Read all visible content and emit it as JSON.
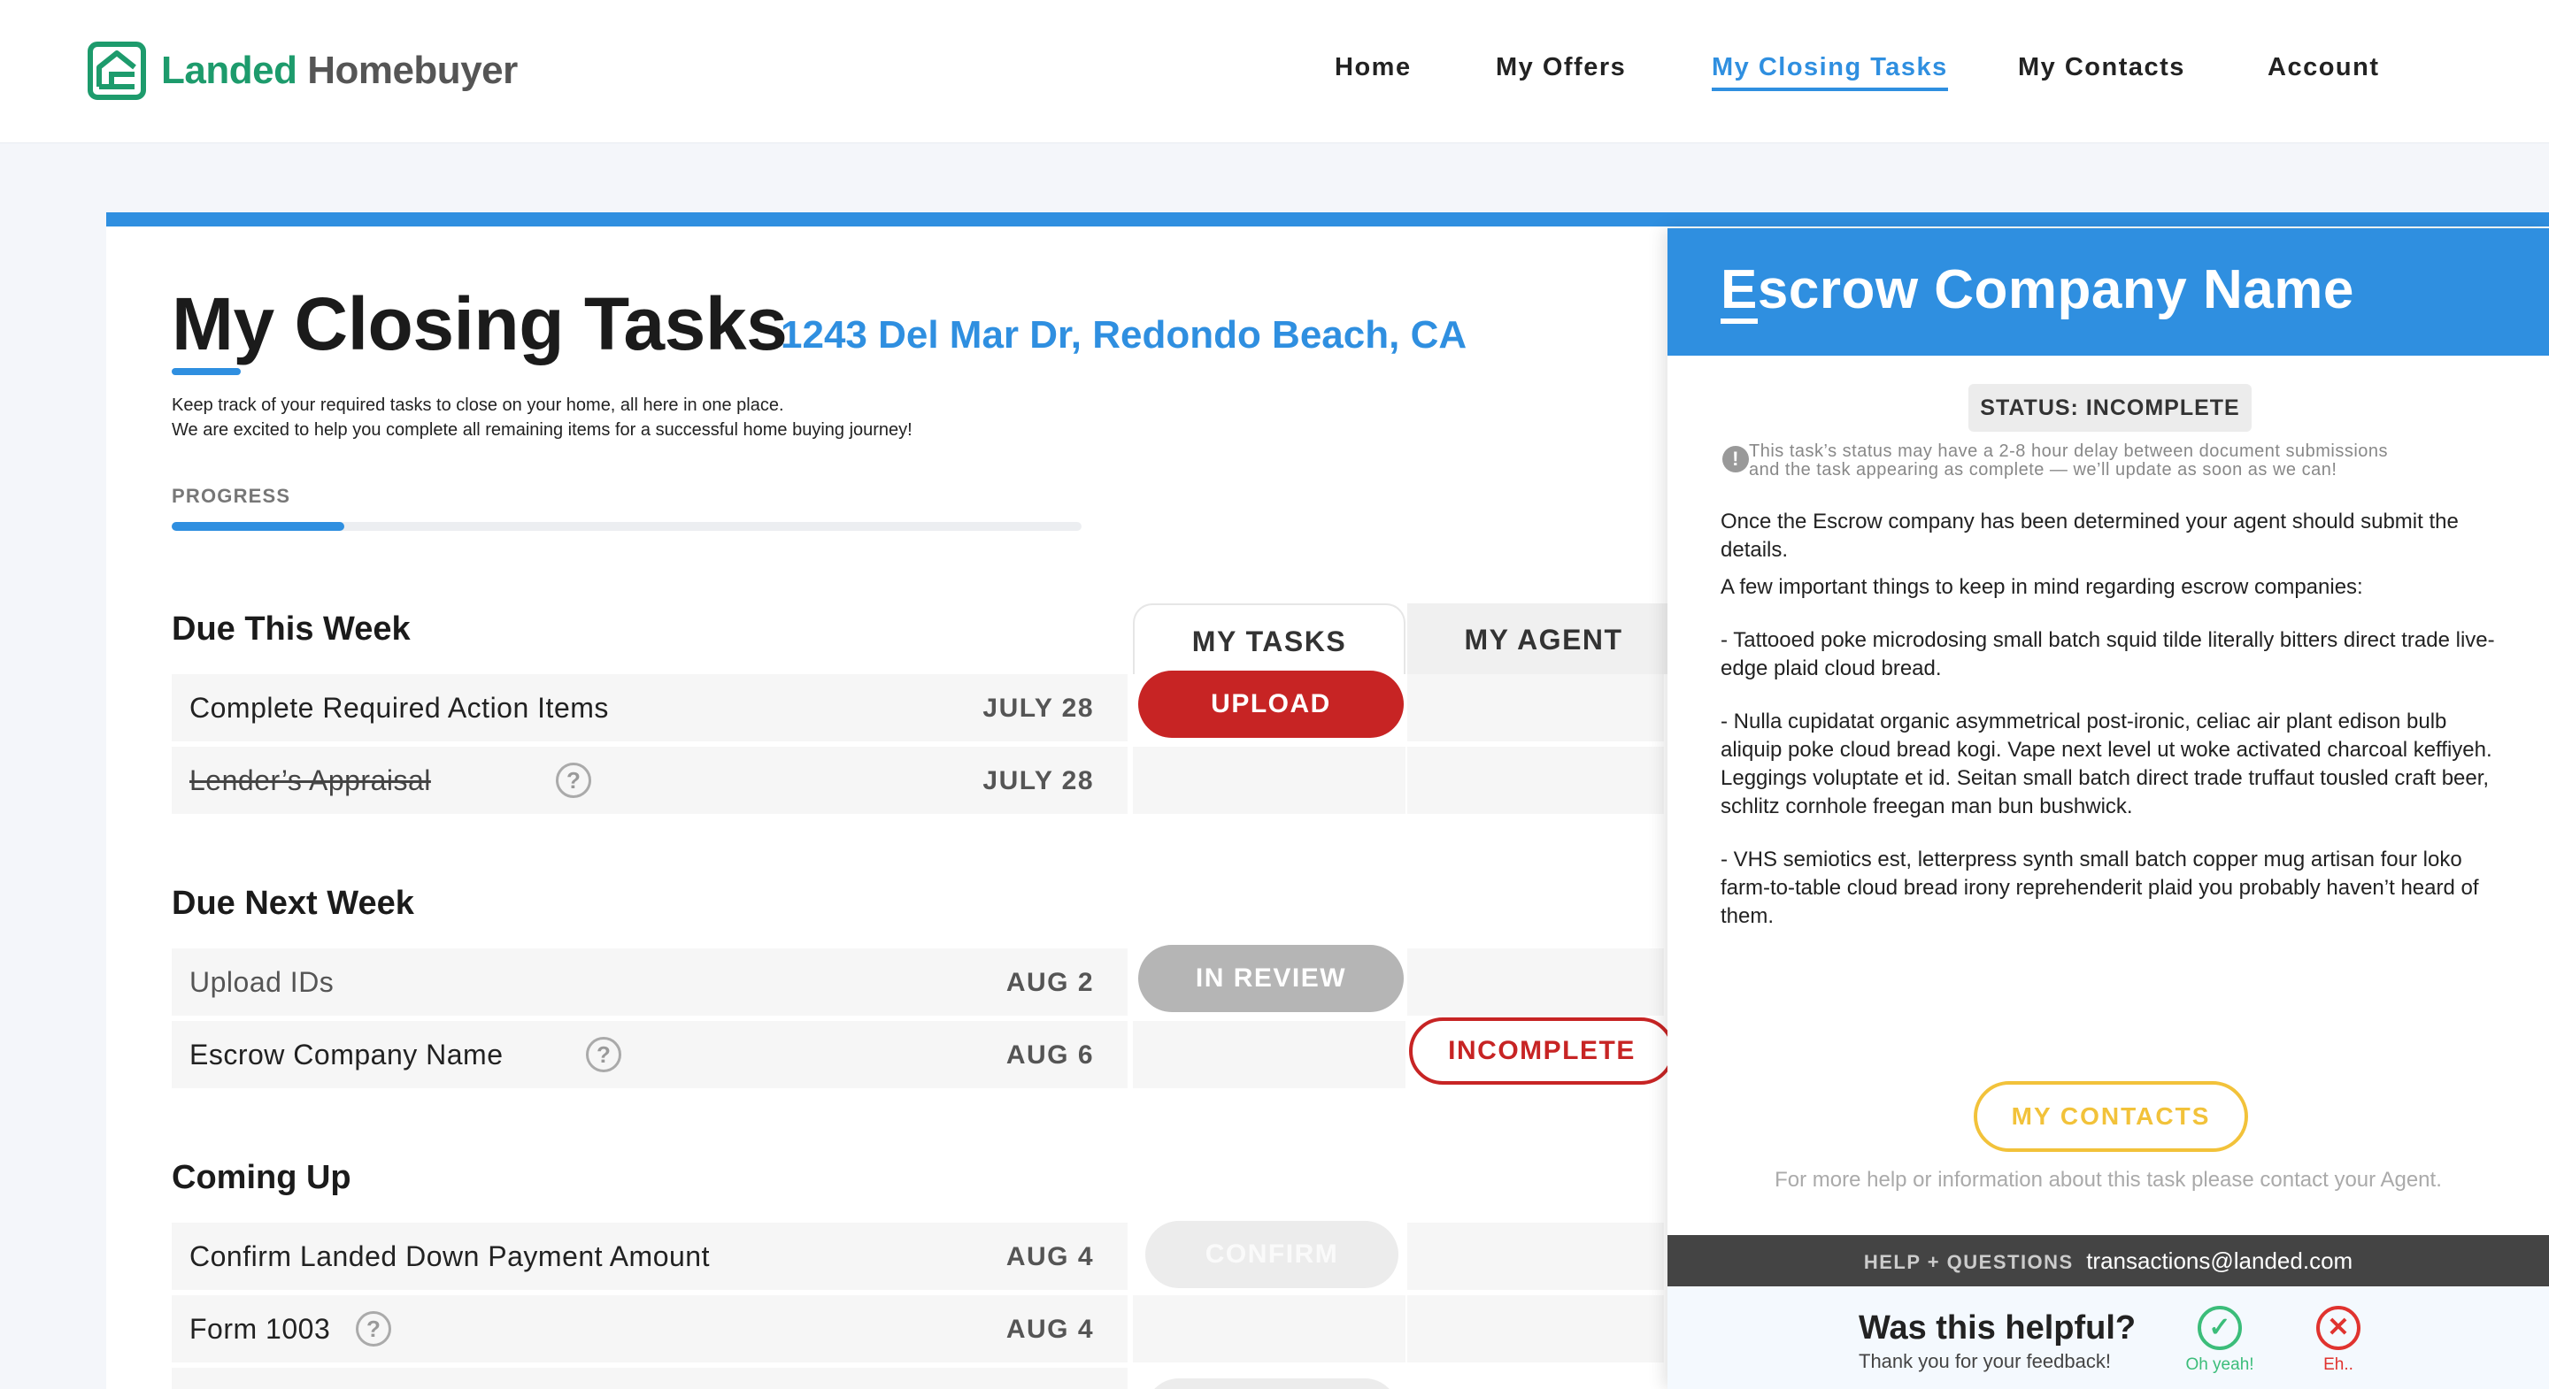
{
  "brand": {
    "name_part1": "Landed",
    "name_part2": "Homebuyer",
    "accent": "#1d9b6c"
  },
  "nav": {
    "items": [
      {
        "label": "Home"
      },
      {
        "label": "My Offers"
      },
      {
        "label": "My Closing Tasks",
        "active": true
      },
      {
        "label": "My Contacts"
      },
      {
        "label": "Account"
      }
    ]
  },
  "page": {
    "title": "My Closing Tasks",
    "address": "1243 Del Mar Dr, Redondo Beach, CA",
    "subtitle_line1": "Keep track of your required tasks to close on your home, all here in one place.",
    "subtitle_line2": "We are excited to help you complete all remaining items for a successful home buying journey!",
    "progress_label": "PROGRESS",
    "progress_fraction": 0.19
  },
  "tabs": {
    "my_tasks": "MY TASKS",
    "my_agent": "MY AGENT"
  },
  "sections": [
    {
      "heading": "Due This Week",
      "tasks": [
        {
          "name": "Complete Required Action Items",
          "date": "JULY 28",
          "my_action": "UPLOAD"
        },
        {
          "name": "Lender’s Appraisal",
          "date": "JULY 28",
          "help_icon": "question-circle-icon",
          "completed": true
        }
      ]
    },
    {
      "heading": "Due Next Week",
      "tasks": [
        {
          "name": "Upload IDs",
          "date": "AUG 2",
          "my_action": "IN REVIEW"
        },
        {
          "name": "Escrow Company Name",
          "date": "AUG 6",
          "help_icon": "question-circle-icon",
          "agent_action": "INCOMPLETE"
        }
      ]
    },
    {
      "heading": "Coming Up",
      "tasks": [
        {
          "name": "Confirm Landed Down Payment Amount",
          "date": "AUG 4",
          "my_action": "CONFIRM"
        },
        {
          "name": "Form 1003",
          "date": "AUG 4",
          "help_icon": "question-circle-icon"
        }
      ]
    }
  ],
  "panel": {
    "title": "Escrow Company Name",
    "status": "STATUS: INCOMPLETE",
    "notice_line1": "This task’s status may have a 2-8 hour delay between document submissions",
    "notice_line2": "and the task appearing as complete — we’ll update as soon as we can!",
    "body": [
      "Once the Escrow company has been determined your agent should submit the details.",
      "A few important things to keep in mind regarding escrow companies:",
      "- Tattooed poke microdosing small batch squid tilde literally bitters direct trade live-edge plaid cloud bread.",
      "- Nulla cupidatat organic asymmetrical post-ironic, celiac air plant edison bulb aliquip poke cloud bread kogi. Vape next level ut woke activated charcoal keffiyeh. Leggings voluptate et id. Seitan small batch direct trade truffaut tousled craft beer, schlitz cornhole freegan man bun bushwick.",
      "- VHS semiotics est, letterpress synth small batch copper mug artisan four loko farm-to-table cloud bread irony reprehenderit plaid you probably haven’t heard of them."
    ],
    "contacts_button": "MY CONTACTS",
    "help_text": "For more help or information about this task please contact your Agent.",
    "help_label": "HELP + QUESTIONS",
    "help_email": "transactions@landed.com",
    "feedback_question": "Was this helpful?",
    "feedback_thanks": "Thank you for your feedback!",
    "feedback_yes": "Oh yeah!",
    "feedback_no": "Eh.."
  }
}
